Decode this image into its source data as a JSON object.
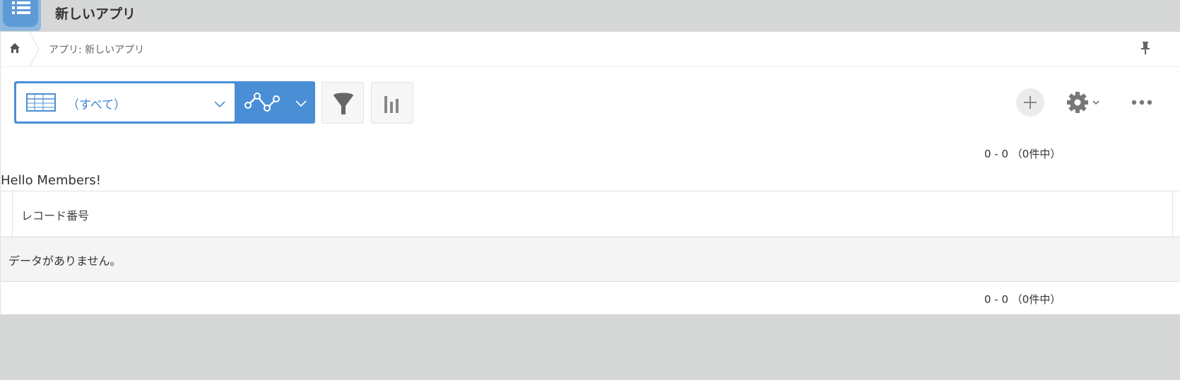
{
  "header": {
    "app_title": "新しいアプリ",
    "app_icon": "list-icon"
  },
  "breadcrumb": {
    "home_icon": "home-icon",
    "text": "アプリ: 新しいアプリ",
    "pin_icon": "pin-icon"
  },
  "toolbar": {
    "view_select": {
      "value": "（すべて）",
      "icon": "table-icon"
    },
    "graph_icon": "line-graph-icon",
    "filter_icon": "filter-icon",
    "chart_icon": "bar-chart-icon",
    "add_icon": "plus-icon",
    "settings_icon": "gear-icon",
    "more_icon": "more-icon"
  },
  "pager": {
    "top": "0 - 0 （0件中）",
    "bottom": "0 - 0 （0件中）"
  },
  "content": {
    "hello": "Hello Members!"
  },
  "table": {
    "columns": [
      "レコード番号"
    ],
    "empty_message": "データがありません。"
  },
  "colors": {
    "accent": "#4a8fd6",
    "topbar_bg": "#d6d8d7",
    "empty_row_bg": "#f4f4f4"
  }
}
